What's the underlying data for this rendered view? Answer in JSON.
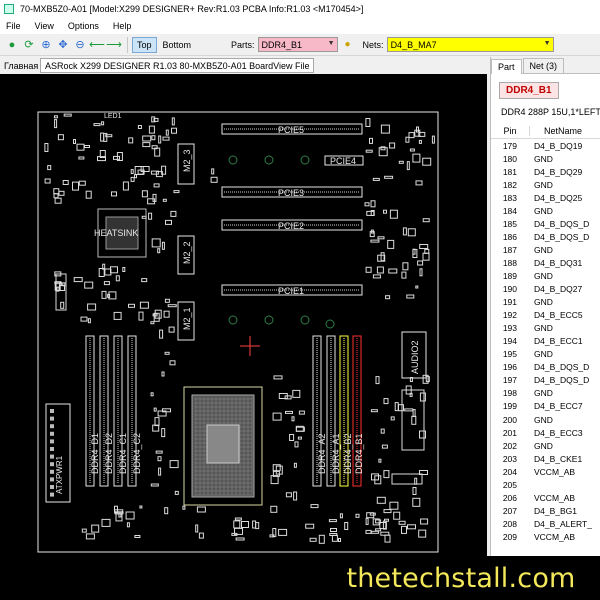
{
  "window": {
    "title": "70-MXB5Z0-A01 [Model:X299 DESIGNER+ Rev:R1.03 PCBA Info:R1.03      <M170454>]"
  },
  "menu": [
    "File",
    "View",
    "Options",
    "Help"
  ],
  "toolbar": {
    "icons": [
      "open-icon",
      "refresh-icon",
      "zoom-in-icon",
      "fit-icon",
      "zoom-out-icon",
      "back-icon",
      "forward-icon"
    ],
    "top_label": "Top",
    "bottom_label": "Bottom",
    "parts_label": "Parts:",
    "parts_value": "DDR4_B1",
    "nets_label": "Nets:",
    "nets_value": "D4_B_MA7",
    "colors": {
      "parts_bg": "#f7b8c8",
      "nets_bg": "#ffff00",
      "top_active": "#cce4f7"
    }
  },
  "doc": {
    "label": "Главная",
    "tab": "ASRock X299 DESIGNER R1.03 80-MXB5Z0-A01 BoardView File"
  },
  "board": {
    "labels": {
      "pcie5": "PCIE5",
      "pcie4": "PCIE4",
      "pcie3": "PCIE3",
      "pcie2": "PCIE2",
      "pcie1": "PCIE1",
      "m2_3": "M2_3",
      "m2_2": "M2_2",
      "m2_1": "M2_1",
      "heatsink": "HEATSINK",
      "audio2": "AUDIO2",
      "atxpwr1": "ATXPWR1",
      "ddr4_d1": "DDR4_D1",
      "ddr4_d2": "DDR4_D2",
      "ddr4_c1": "DDR4_C1",
      "ddr4_c2": "DDR4_C2",
      "ddr4_a2": "DDR4_A2",
      "ddr4_a1": "DDR4_A1",
      "ddr4_b2": "DDR4_B2",
      "ddr4_b1": "DDR4_B1",
      "led1": "LED1"
    },
    "colors": {
      "board_bg": "#000000",
      "outline": "#e6e6e6",
      "selected_net": "#ffff40",
      "selected_part": "#ff3030",
      "ic": "#9a9a9a"
    }
  },
  "panel": {
    "tabs": [
      "Part",
      "Net (3)"
    ],
    "part_name": "DDR4_B1",
    "part_desc": "DDR4 288P 15U,1*LEFT,",
    "columns": [
      "Pin",
      "NetName"
    ],
    "rows": [
      {
        "pin": "179",
        "net": "D4_B_DQ19"
      },
      {
        "pin": "180",
        "net": "GND"
      },
      {
        "pin": "181",
        "net": "D4_B_DQ29"
      },
      {
        "pin": "182",
        "net": "GND"
      },
      {
        "pin": "183",
        "net": "D4_B_DQ25"
      },
      {
        "pin": "184",
        "net": "GND"
      },
      {
        "pin": "185",
        "net": "D4_B_DQS_D"
      },
      {
        "pin": "186",
        "net": "D4_B_DQS_D"
      },
      {
        "pin": "187",
        "net": "GND"
      },
      {
        "pin": "188",
        "net": "D4_B_DQ31"
      },
      {
        "pin": "189",
        "net": "GND"
      },
      {
        "pin": "190",
        "net": "D4_B_DQ27"
      },
      {
        "pin": "191",
        "net": "GND"
      },
      {
        "pin": "192",
        "net": "D4_B_ECC5"
      },
      {
        "pin": "193",
        "net": "GND"
      },
      {
        "pin": "194",
        "net": "D4_B_ECC1"
      },
      {
        "pin": "195",
        "net": "GND"
      },
      {
        "pin": "196",
        "net": "D4_B_DQS_D"
      },
      {
        "pin": "197",
        "net": "D4_B_DQS_D"
      },
      {
        "pin": "198",
        "net": "GND"
      },
      {
        "pin": "199",
        "net": "D4_B_ECC7"
      },
      {
        "pin": "200",
        "net": "GND"
      },
      {
        "pin": "201",
        "net": "D4_B_ECC3"
      },
      {
        "pin": "202",
        "net": "GND"
      },
      {
        "pin": "203",
        "net": "D4_B_CKE1"
      },
      {
        "pin": "204",
        "net": "VCCM_AB"
      },
      {
        "pin": "205",
        "net": ""
      },
      {
        "pin": "206",
        "net": "VCCM_AB"
      },
      {
        "pin": "207",
        "net": "D4_B_BG1"
      },
      {
        "pin": "208",
        "net": "D4_B_ALERT_"
      },
      {
        "pin": "209",
        "net": "VCCM_AB"
      }
    ]
  },
  "watermark": "thetechstall.com"
}
